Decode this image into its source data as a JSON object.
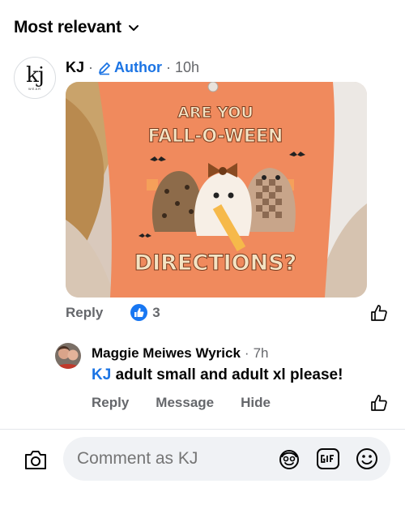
{
  "sort": {
    "label": "Most relevant",
    "icon": "chevron-down-icon"
  },
  "comment": {
    "avatar": {
      "logo": "kj",
      "logo_sub": "WEAR"
    },
    "author": "KJ",
    "sep": "·",
    "badge_label": "Author",
    "time": "10h",
    "image": {
      "alt_icon": "shirt-photo",
      "shirt_text_top": [
        "ARE YOU",
        "FALL-O-WEEN"
      ],
      "shirt_text_bottom": "DIRECTIONS?"
    },
    "reply_label": "Reply",
    "reaction_count": "3"
  },
  "reply": {
    "author": "Maggie Meiwes Wyrick",
    "sep": "·",
    "time": "7h",
    "mention": "KJ",
    "text": " adult small and adult xl please!",
    "actions": [
      "Reply",
      "Message",
      "Hide"
    ]
  },
  "composer": {
    "placeholder": "Comment as KJ"
  },
  "colors": {
    "accent": "#1b74e4",
    "like": "#1877f2",
    "muted": "#65676b",
    "composer_bg": "#f0f2f5",
    "shirt": "#f08a5d"
  }
}
